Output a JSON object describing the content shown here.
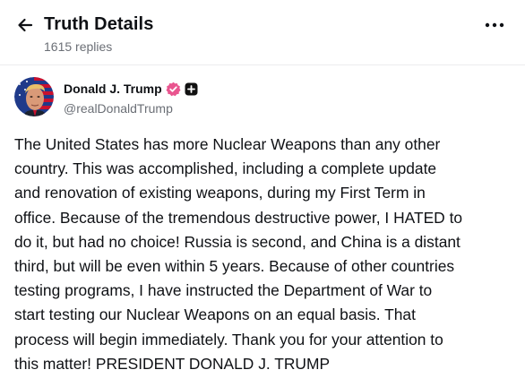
{
  "header": {
    "title": "Truth Details",
    "replies": "1615 replies",
    "back_icon": "arrow-left-icon",
    "more_icon": "more-horizontal-icon"
  },
  "author": {
    "display_name": "Donald J. Trump",
    "handle": "@realDonaldTrump",
    "verified_icon": "verified-badge-icon",
    "badge_icon": "plus-badge-icon",
    "verified_color": "#e9558f"
  },
  "post": {
    "text": "The United States has more Nuclear Weapons than any other\ncountry. This was accomplished, including a complete update\nand renovation of existing weapons, during my First Term in\noffice. Because of the tremendous destructive power, I HATED to\ndo it, but had no choice! Russia is second, and China is a distant\nthird, but will be even within 5 years. Because of other countries\ntesting programs, I have instructed the Department of War to\nstart testing our Nuclear Weapons on an equal basis. That\nprocess will begin immediately. Thank you for your attention to\nthis matter! PRESIDENT DONALD J. TRUMP"
  }
}
